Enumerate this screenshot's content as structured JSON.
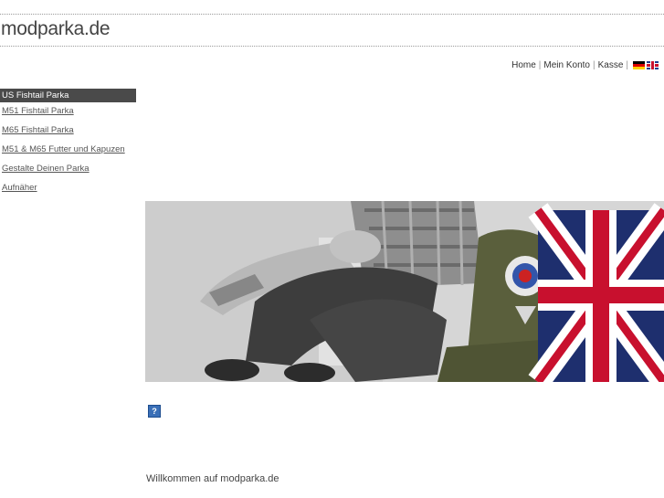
{
  "header": {
    "logo": "modparka.de"
  },
  "topnav": {
    "links": [
      "Home",
      "Mein Konto",
      "Kasse"
    ],
    "separator": "|",
    "flags": [
      "german-flag-icon",
      "uk-flag-icon"
    ]
  },
  "sidebar": {
    "items": [
      {
        "label": "US Fishtail Parka",
        "active": true
      },
      {
        "label": "M51 Fishtail Parka",
        "active": false
      },
      {
        "label": "M65 Fishtail Parka",
        "active": false
      },
      {
        "label": "M51 & M65 Futter und Kapuzen",
        "active": false
      },
      {
        "label": "Gestalte Deinen Parka",
        "active": false
      },
      {
        "label": "Aufnäher",
        "active": false
      }
    ]
  },
  "content": {
    "help_icon": "?",
    "welcome": "Willkommen auf modparka.de"
  },
  "colors": {
    "active_bg": "#4a4a4a",
    "text": "#333333"
  }
}
